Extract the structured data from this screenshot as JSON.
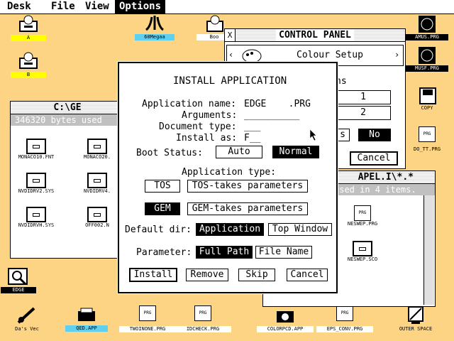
{
  "menubar": {
    "items": [
      "Desk",
      "File",
      "View",
      "Options"
    ],
    "active": "Options"
  },
  "desktop_icons": [
    {
      "name": "drive-a",
      "label": "A"
    },
    {
      "name": "drive-b",
      "label": "B"
    },
    {
      "name": "atari-60megaa",
      "label": "60Megaa",
      "logo": "ATARI"
    },
    {
      "name": "drive-boot",
      "label": "Boo"
    },
    {
      "name": "sl-samus-prg",
      "label": "AMUS.PRG"
    },
    {
      "name": "samus-musf-prg",
      "label": "MUSF.PRG"
    },
    {
      "name": "copy",
      "label": "COPY"
    },
    {
      "name": "do-tt-prg",
      "label": "DO_TT.PRG"
    },
    {
      "name": "edge",
      "label": "EDGE"
    },
    {
      "name": "das-vec",
      "label": "Da's Vec"
    },
    {
      "name": "qed-app",
      "label": "QED.APP"
    },
    {
      "name": "twoinone-prg",
      "label": "TWOINONE.PRG"
    },
    {
      "name": "idcheck-prg",
      "label": "IDCHECK.PRG"
    },
    {
      "name": "colorpcd-app",
      "label": "COLORPCD.APP"
    },
    {
      "name": "eps-conv-prg",
      "label": "EPS_CONV.PRG"
    },
    {
      "name": "outer-space",
      "label": "OUTER SPACE"
    }
  ],
  "left_window": {
    "title": "C:\\GE",
    "status": "346320 bytes used",
    "files": [
      "MONACO10.FNT",
      "MONACO20.",
      "NVDIDRV2.SYS",
      "NVDIDRV4.",
      "NVDIDRVH.SYS",
      "OFF002.N"
    ]
  },
  "right_window": {
    "title": "APEL.I\\*.*",
    "status": "used in 4 items.",
    "files": [
      "NESWEP.PRG",
      "NESWEP.SCO"
    ]
  },
  "control_panel": {
    "title": "CONTROL PANEL",
    "close": "X",
    "selector": "Colour Setup",
    "fields": [
      "1",
      "2"
    ],
    "fragment": "ns",
    "buttons": {
      "s": "s",
      "no": "No",
      "cancel": "Cancel"
    }
  },
  "dialog": {
    "title": "INSTALL APPLICATION",
    "labels": {
      "app_name": "Application name:",
      "arguments": "Arguments:",
      "doc_type": "Document type:",
      "install_as": "Install as:",
      "boot_status": "Boot Status:",
      "app_type": "Application type:",
      "default_dir": "Default dir:",
      "parameter": "Parameter:"
    },
    "values": {
      "app_name": "EDGE    .PRG",
      "arguments": "__________",
      "doc_type": "___",
      "install_as": "F__"
    },
    "buttons": {
      "auto": "Auto",
      "normal": "Normal",
      "tos": "TOS",
      "tos_params": "TOS-takes parameters",
      "gem": "GEM",
      "gem_params": "GEM-takes parameters",
      "application": "Application",
      "top_window": "Top Window",
      "full_path": "Full Path",
      "file_name": "File Name",
      "install": "Install",
      "remove": "Remove",
      "skip": "Skip",
      "cancel": "Cancel"
    },
    "selected": [
      "normal",
      "gem",
      "application",
      "full_path"
    ]
  },
  "colors": {
    "desktop": "#fcd484",
    "selected": "#000000",
    "label_highlight": "#ffff00",
    "label_cyan": "#60d0f0"
  }
}
